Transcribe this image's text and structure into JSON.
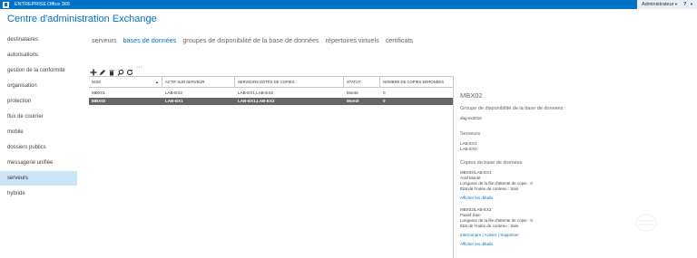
{
  "topbar": {
    "brand1": "ENTREPRISE",
    "brand2": "Office 365",
    "admin": "Administrateur",
    "help": "?",
    "bg": "#0072c6"
  },
  "app_title": "Centre d'administration Exchange",
  "sidebar": {
    "items": [
      {
        "label": "destinataires"
      },
      {
        "label": "autorisations"
      },
      {
        "label": "gestion de la conformité"
      },
      {
        "label": "organisation"
      },
      {
        "label": "protection"
      },
      {
        "label": "flux de courrier"
      },
      {
        "label": "mobile"
      },
      {
        "label": "dossiers publics"
      },
      {
        "label": "messagerie unifiée"
      },
      {
        "label": "serveurs",
        "active": true
      },
      {
        "label": "hybride"
      }
    ]
  },
  "tabs": [
    {
      "label": "serveurs"
    },
    {
      "label": "bases de données",
      "active": true
    },
    {
      "label": "groupes de disponibilité de la base de données"
    },
    {
      "label": "répertoires virtuels"
    },
    {
      "label": "certificats"
    }
  ],
  "toolbar": {
    "icons": [
      "add-icon",
      "edit-icon",
      "delete-icon",
      "search-icon",
      "refresh-icon",
      "more-icon"
    ],
    "more": "···"
  },
  "table": {
    "headers": [
      "NOM",
      "ACTIF SUR SERVEUR",
      "SERVEURS DOTÉS DE COPIES",
      "STATUT",
      "NOMBRE DE COPIES ERRONÉES"
    ],
    "rows": [
      {
        "nom": "MBX01",
        "actif": "LAB-EX2",
        "serveurs": "LAB-EX1,LAB-EX2",
        "statut": "Monté",
        "erronees": "0"
      },
      {
        "nom": "MBX02",
        "actif": "LAB-EX1",
        "serveurs": "LAB-EX1,LAB-EX2",
        "statut": "Monté",
        "erronees": "0",
        "selected": true
      }
    ]
  },
  "details": {
    "title": "MBX02",
    "dag_label": "Groupe de disponibilité de la base de données :",
    "dag_value": "dag-ex2016",
    "servers_label": "Serveurs",
    "servers": [
      "LAB-EX1",
      "LAB-EX2"
    ],
    "copies_label": "Copies de base de données",
    "copy1": {
      "name": "MBX02\\LAB-EX1",
      "status": "Actif Monté",
      "queue": "Longueur de la file d'attente de copie : 0",
      "index": "État de l'index de contenu : Sain",
      "link": "Afficher les détails"
    },
    "copy2": {
      "name": "MBX02\\LAB-EX2",
      "status": "Passif Sain",
      "queue": "Longueur de la file d'attente de copie : 0",
      "index": "État de l'index de contenu : Sain",
      "actions": "Interrompre | Activer | Supprimer",
      "link": "Afficher les détails"
    }
  },
  "colors": {
    "accent": "#0072c6",
    "selected_row": "#666666",
    "active_nav": "#cde6f7"
  }
}
